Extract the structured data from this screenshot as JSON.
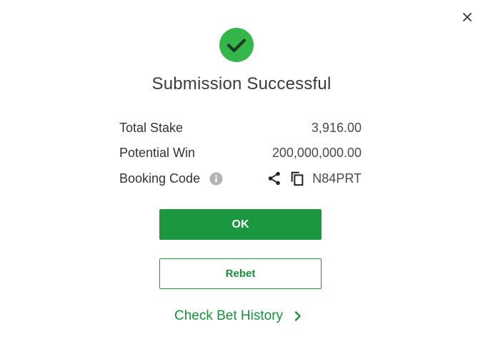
{
  "dialog": {
    "title": "Submission Successful",
    "colors": {
      "accent": "#1b973f",
      "success_icon": "#35b64a"
    },
    "icons": {
      "close": "close-icon",
      "status": "check-circle-icon",
      "info": "info-icon",
      "share": "share-icon",
      "copy": "copy-icon",
      "chevron": "chevron-right-icon"
    }
  },
  "summary": {
    "stake_label": "Total Stake",
    "stake_value": "3,916.00",
    "win_label": "Potential Win",
    "win_value": "200,000,000.00",
    "booking_label": "Booking Code",
    "booking_code": "N84PRT"
  },
  "actions": {
    "ok_label": "OK",
    "rebet_label": "Rebet",
    "history_label": "Check Bet History"
  }
}
